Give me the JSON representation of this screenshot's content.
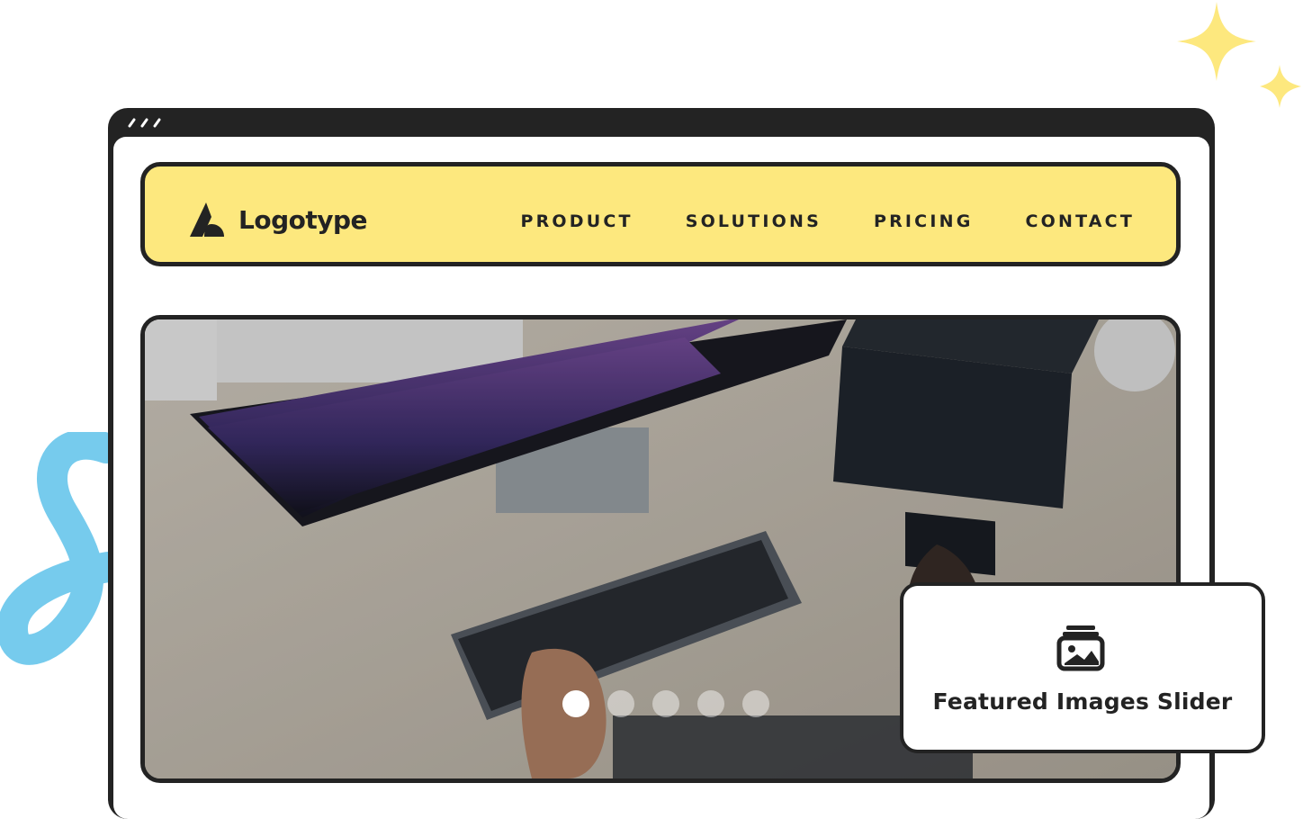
{
  "header": {
    "logo_text": "Logotype",
    "nav": [
      {
        "label": "PRODUCT"
      },
      {
        "label": "SOLUTIONS"
      },
      {
        "label": "PRICING"
      },
      {
        "label": "CONTACT"
      }
    ]
  },
  "slider": {
    "image": "desk-workspace-photo",
    "dot_count": 5,
    "active_index": 0
  },
  "feature_card": {
    "icon": "image-gallery-icon",
    "label": "Featured Images Slider"
  },
  "colors": {
    "navbar_bg": "#fde87e",
    "frame": "#232323",
    "sparkle": "#fde87e",
    "squiggle": "#6fc8ec"
  }
}
